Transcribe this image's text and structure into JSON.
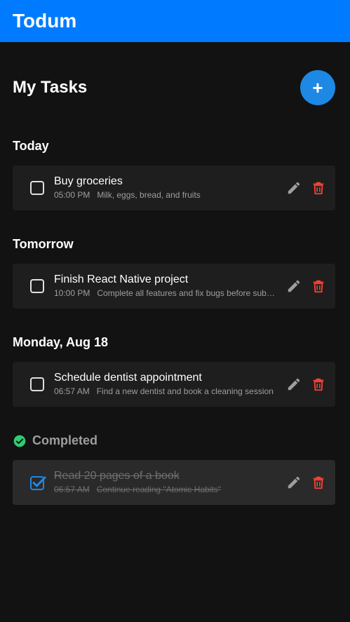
{
  "app": {
    "title": "Todum"
  },
  "page": {
    "title": "My Tasks",
    "add_button_label": "+"
  },
  "sections": [
    {
      "title": "Today",
      "tasks": [
        {
          "title": "Buy groceries",
          "time": "05:00 PM",
          "description": "Milk, eggs, bread, and fruits",
          "completed": false
        }
      ]
    },
    {
      "title": "Tomorrow",
      "tasks": [
        {
          "title": "Finish React Native project",
          "time": "10:00 PM",
          "description": "Complete all features and fix bugs before sub…",
          "completed": false
        }
      ]
    },
    {
      "title": "Monday, Aug 18",
      "tasks": [
        {
          "title": "Schedule dentist appointment",
          "time": "06:57 AM",
          "description": "Find a new dentist and book a cleaning session",
          "completed": false
        }
      ]
    }
  ],
  "completed": {
    "title": "Completed",
    "tasks": [
      {
        "title": "Read 20 pages of a book",
        "time": "06:57 AM",
        "description": "Continue reading \"Atomic Habits\"",
        "completed": true
      }
    ]
  },
  "colors": {
    "appbar": "#007bff",
    "accent": "#1e88e5",
    "delete": "#f44336",
    "completed_check": "#2ecc71",
    "background": "#121212"
  },
  "icons": {
    "edit": "pencil-icon",
    "delete": "trash-icon",
    "checkbox": "checkbox-outline-icon",
    "checkbox_checked": "checkbox-checked-icon",
    "completed": "check-circle-icon"
  }
}
